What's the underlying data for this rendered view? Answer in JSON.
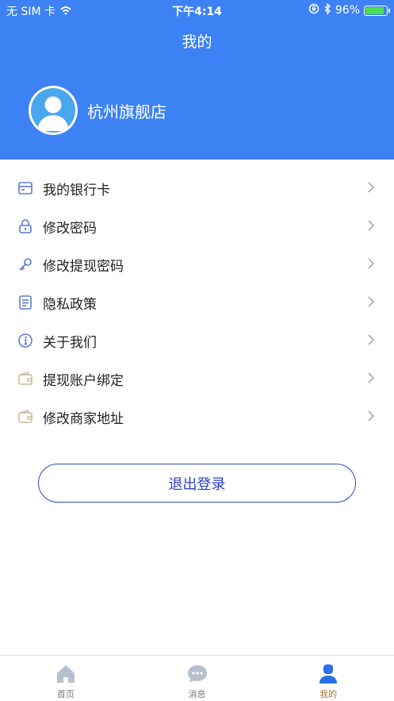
{
  "status_bar": {
    "carrier": "无 SIM 卡",
    "time": "下午4:14",
    "battery": "96%",
    "battery_level": 0.96
  },
  "header": {
    "title": "我的",
    "user_name": "杭州旗舰店"
  },
  "menu": {
    "items": [
      {
        "label": "我的银行卡",
        "icon": "bank-card-icon"
      },
      {
        "label": "修改密码",
        "icon": "lock-icon"
      },
      {
        "label": "修改提现密码",
        "icon": "key-icon"
      },
      {
        "label": "隐私政策",
        "icon": "document-icon"
      },
      {
        "label": "关于我们",
        "icon": "info-icon"
      },
      {
        "label": "提现账户绑定",
        "icon": "wallet-icon"
      },
      {
        "label": "修改商家地址",
        "icon": "wallet-icon"
      }
    ]
  },
  "logout_label": "退出登录",
  "tabbar": {
    "tabs": [
      {
        "label": "首页",
        "icon": "home-icon",
        "active": false
      },
      {
        "label": "消息",
        "icon": "chat-icon",
        "active": false
      },
      {
        "label": "我的",
        "icon": "person-icon",
        "active": true
      }
    ]
  },
  "colors": {
    "header_bg": "#3d82f5",
    "logout_border": "#3545c6",
    "active_tab": "#b0723c",
    "icon_blue": "#5b78d6"
  }
}
